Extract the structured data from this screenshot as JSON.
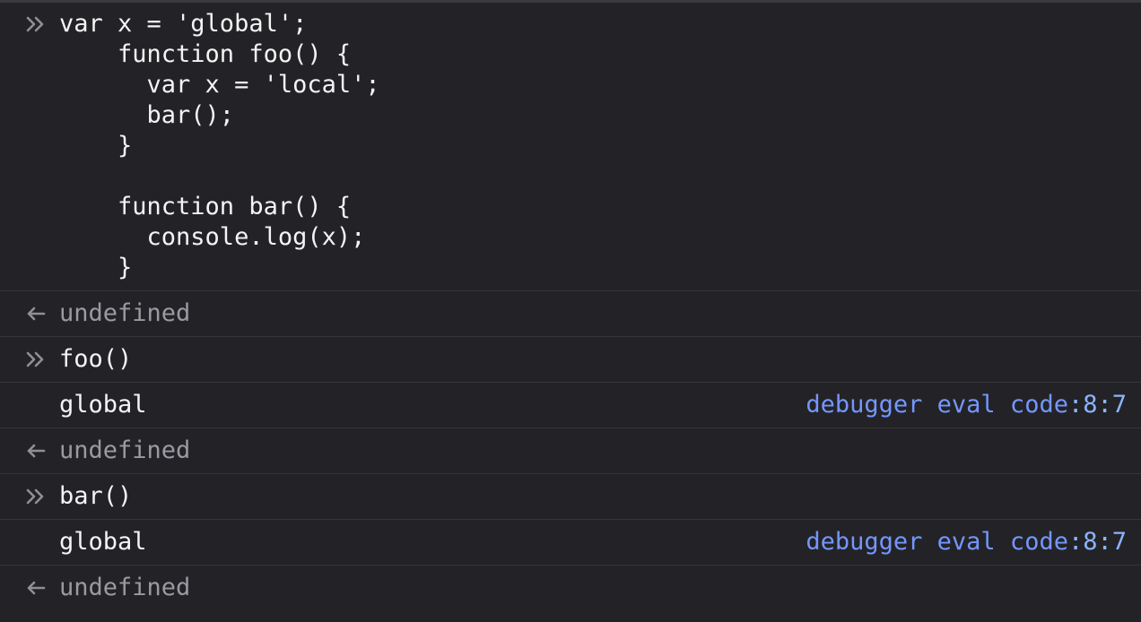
{
  "console": {
    "block1": {
      "input_lines": [
        "var x = 'global';",
        "    function foo() {",
        "      var x = 'local';",
        "      bar();",
        "    }",
        "",
        "    function bar() {",
        "      console.log(x);",
        "    }"
      ],
      "result": "undefined"
    },
    "block2": {
      "input": "foo()",
      "log_output": "global",
      "log_location": "debugger eval code",
      "log_line_col": ":8:7",
      "result": "undefined"
    },
    "block3": {
      "input": "bar()",
      "log_output": "global",
      "log_location": "debugger eval code",
      "log_line_col": ":8:7",
      "result": "undefined"
    }
  },
  "icons": {
    "input": "double-chevron-right-icon",
    "result": "arrow-left-icon"
  },
  "colors": {
    "background": "#232327",
    "text": "#f4f4f5",
    "dim_text": "#9a9aa0",
    "location": "#7596ff",
    "icon": "#8f8f95"
  }
}
